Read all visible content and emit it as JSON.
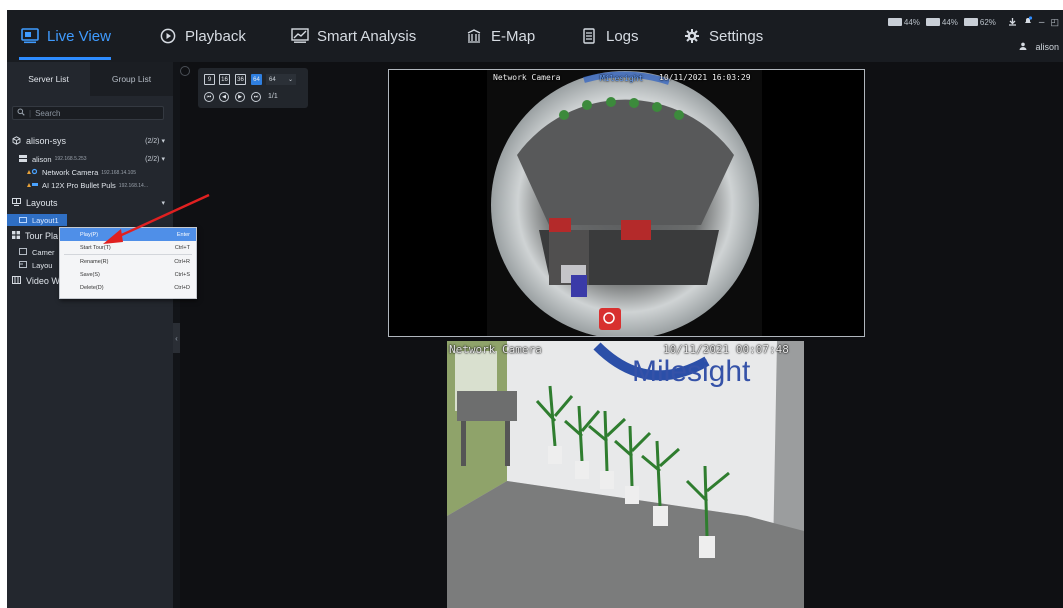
{
  "nav": {
    "tabs": [
      {
        "label": "Live View",
        "icon": "monitor-icon",
        "active": true
      },
      {
        "label": "Playback",
        "icon": "play-circle-icon"
      },
      {
        "label": "Smart Analysis",
        "icon": "chart-icon"
      },
      {
        "label": "E-Map",
        "icon": "map-icon"
      },
      {
        "label": "Logs",
        "icon": "document-icon"
      },
      {
        "label": "Settings",
        "icon": "gear-icon"
      }
    ],
    "accent": "#2e8cff"
  },
  "system": {
    "cpu": "44%",
    "memory": "44%",
    "disk": "62%",
    "user": "alison"
  },
  "sidebar": {
    "tabs": [
      "Server List",
      "Group List"
    ],
    "search_placeholder": "Search",
    "tree": {
      "server_group": {
        "label": "alison-sys",
        "count": "(2/2)"
      },
      "server": {
        "label": "alison",
        "ip": "192.168.5.253",
        "count": "(2/2)"
      },
      "cameras": [
        {
          "label": "Network Camera",
          "ip": "192.168.14.105"
        },
        {
          "label": "AI 12X Pro Bullet Puls",
          "ip": "192.168.14..."
        }
      ],
      "layouts": {
        "label": "Layouts",
        "item": "Layout1"
      },
      "tour_plan": {
        "label": "Tour Pla",
        "items": [
          "Camer",
          "Layou"
        ]
      },
      "video_wall": {
        "label": "Video W"
      }
    }
  },
  "context_menu": {
    "items": [
      {
        "label": "Play(P)",
        "shortcut": "Enter",
        "highlighted": true
      },
      {
        "label": "Start Tour(T)",
        "shortcut": "Ctrl+T"
      },
      {
        "label": "Rename(R)",
        "shortcut": "Ctrl+R"
      },
      {
        "label": "Save(S)",
        "shortcut": "Ctrl+S"
      },
      {
        "label": "Delete(D)",
        "shortcut": "Ctrl+D"
      }
    ]
  },
  "layout_control": {
    "buttons": [
      "9",
      "16",
      "36",
      "64"
    ],
    "selected": "64",
    "select_value": "64",
    "page": "1/1"
  },
  "cameras": [
    {
      "name": "Network Camera",
      "timestamp": "10/11/2021 16:03:29",
      "logo": "Milesight"
    },
    {
      "name": "Network Camera",
      "timestamp": "10/11/2021 00:07:48",
      "logo": "Milesight"
    }
  ]
}
